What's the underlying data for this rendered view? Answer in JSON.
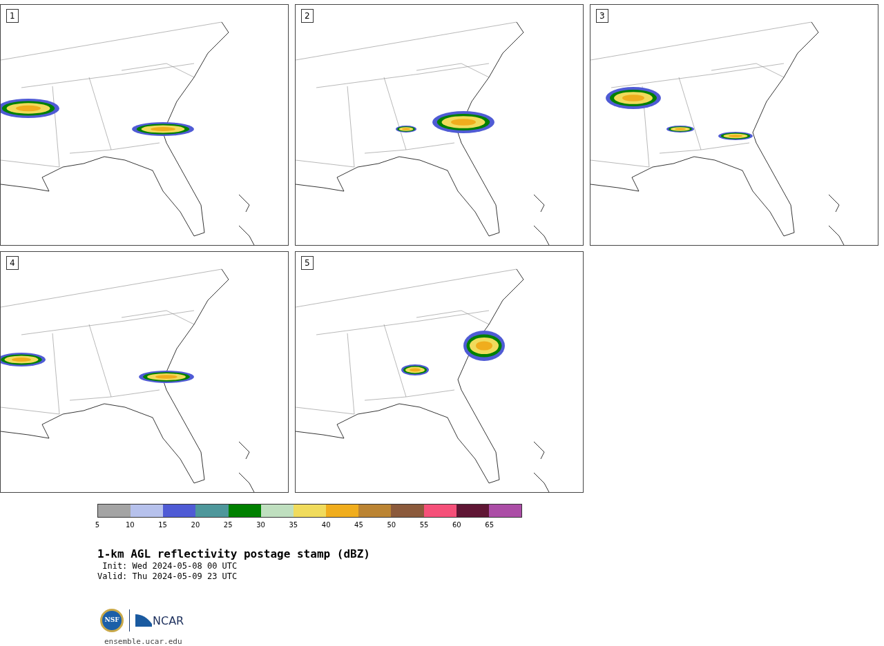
{
  "panels": [
    {
      "label": "1"
    },
    {
      "label": "2"
    },
    {
      "label": "3"
    },
    {
      "label": "4"
    },
    {
      "label": "5"
    }
  ],
  "colorbar": {
    "segments": [
      {
        "color": "#a4a4a4"
      },
      {
        "color": "#b6c1ec"
      },
      {
        "color": "#4f5bd5"
      },
      {
        "color": "#4e979b"
      },
      {
        "color": "#008000"
      },
      {
        "color": "#bfdfbf"
      },
      {
        "color": "#f0db5c"
      },
      {
        "color": "#f0ad1d"
      },
      {
        "color": "#bb8433"
      },
      {
        "color": "#8b5a3c"
      },
      {
        "color": "#f55079"
      },
      {
        "color": "#5f1634"
      },
      {
        "color": "#ab4da6"
      }
    ],
    "ticks": [
      "5",
      "10",
      "15",
      "20",
      "25",
      "30",
      "35",
      "40",
      "45",
      "50",
      "55",
      "60",
      "65"
    ]
  },
  "title": "1-km AGL reflectivity postage stamp (dBZ)",
  "init": " Init: Wed 2024-05-08 00 UTC",
  "valid": "Valid: Thu 2024-05-09 23 UTC",
  "logo": {
    "nsf": "NSF",
    "ncar": "NCAR"
  },
  "site": "ensemble.ucar.edu"
}
